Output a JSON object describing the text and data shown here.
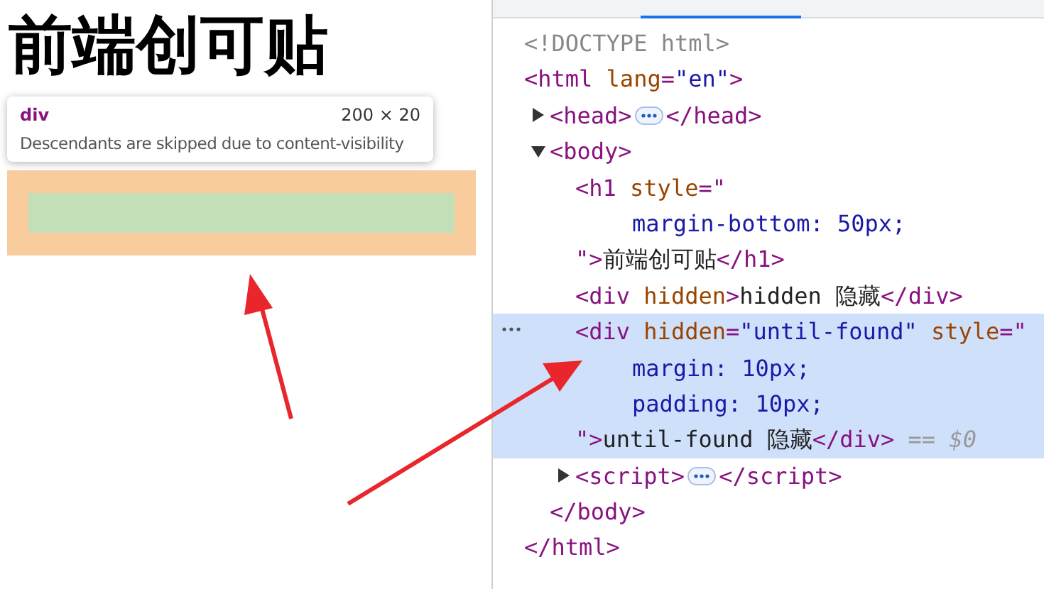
{
  "page": {
    "heading": "前端创可贴"
  },
  "tooltip": {
    "tag": "div",
    "size": "200 × 20",
    "message": "Descendants are skipped due to content-visibility"
  },
  "elements_panel": {
    "nodes": [
      {
        "lines": [
          [
            {
              "kind": "doctype",
              "text": "<!DOCTYPE html>"
            }
          ]
        ]
      },
      {
        "lines": [
          [
            {
              "kind": "tag",
              "text": "<html "
            },
            {
              "kind": "attr",
              "text": "lang"
            },
            {
              "kind": "tag",
              "text": "="
            },
            {
              "kind": "value",
              "text": "\"en\""
            },
            {
              "kind": "tag",
              "text": ">"
            }
          ]
        ],
        "close": [
          {
            "kind": "tag",
            "text": "</html>"
          }
        ],
        "children": [
          {
            "expanded": false,
            "selected": false,
            "lines": [
              [
                {
                  "kind": "tag",
                  "text": "<head>"
                }
              ]
            ],
            "close": [
              {
                "kind": "tag",
                "text": "</head>"
              }
            ]
          },
          {
            "expanded": true,
            "selected": false,
            "lines": [
              [
                {
                  "kind": "tag",
                  "text": "<body>"
                }
              ]
            ],
            "close": [
              {
                "kind": "tag",
                "text": "</body>"
              }
            ],
            "children": [
              {
                "selected": false,
                "lines": [
                  [
                    {
                      "kind": "tag",
                      "text": "<h1 "
                    },
                    {
                      "kind": "attr",
                      "text": "style"
                    },
                    {
                      "kind": "tag",
                      "text": "=\""
                    }
                  ],
                  [
                    {
                      "kind": "css",
                      "text": "margin-bottom: 50px;"
                    }
                  ],
                  [
                    {
                      "kind": "tag",
                      "text": "\">"
                    },
                    {
                      "kind": "text",
                      "text": "前端创可贴"
                    },
                    {
                      "kind": "tag",
                      "text": "</h1>"
                    }
                  ]
                ]
              },
              {
                "selected": false,
                "lines": [
                  [
                    {
                      "kind": "tag",
                      "text": "<div "
                    },
                    {
                      "kind": "attr",
                      "text": "hidden"
                    },
                    {
                      "kind": "tag",
                      "text": ">"
                    },
                    {
                      "kind": "text",
                      "text": "hidden 隐藏"
                    },
                    {
                      "kind": "tag",
                      "text": "</div>"
                    }
                  ]
                ]
              },
              {
                "selected": true,
                "lines": [
                  [
                    {
                      "kind": "tag",
                      "text": "<div "
                    },
                    {
                      "kind": "attr",
                      "text": "hidden"
                    },
                    {
                      "kind": "tag",
                      "text": "="
                    },
                    {
                      "kind": "value",
                      "text": "\"until-found\""
                    },
                    {
                      "kind": "attr",
                      "text": " style"
                    },
                    {
                      "kind": "tag",
                      "text": "=\""
                    }
                  ],
                  [
                    {
                      "kind": "css",
                      "text": "margin: 10px;"
                    }
                  ],
                  [
                    {
                      "kind": "css",
                      "text": "padding: 10px;"
                    }
                  ],
                  [
                    {
                      "kind": "tag",
                      "text": "\">"
                    },
                    {
                      "kind": "text",
                      "text": "until-found 隐藏"
                    },
                    {
                      "kind": "tag",
                      "text": "</div>"
                    },
                    {
                      "kind": "ref",
                      "text": " == $0"
                    }
                  ]
                ]
              },
              {
                "expanded": false,
                "selected": false,
                "lines": [
                  [
                    {
                      "kind": "tag",
                      "text": "<script>"
                    }
                  ]
                ],
                "close": [
                  {
                    "kind": "tag",
                    "text": "</script>"
                  }
                ]
              }
            ]
          }
        ]
      }
    ]
  }
}
